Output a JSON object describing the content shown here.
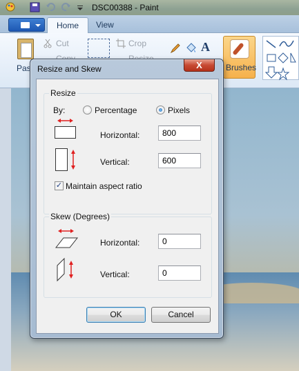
{
  "app": {
    "title": "DSC00388 - Paint",
    "tabs": [
      {
        "label": "Home"
      },
      {
        "label": "View"
      }
    ],
    "clipboard": {
      "paste_label": "Paste",
      "cut_label": "Cut",
      "copy_label": "Copy"
    },
    "image": {
      "crop_label": "Crop",
      "resize_label": "Resize"
    },
    "brushes_label": "Brushes"
  },
  "dialog": {
    "title": "Resize and Skew",
    "close_label": "X",
    "resize": {
      "group_label": "Resize",
      "by_label": "By:",
      "percentage_label": "Percentage",
      "pixels_label": "Pixels",
      "selected_unit": "Pixels",
      "horizontal_label": "Horizontal:",
      "horizontal_value": "800",
      "vertical_label": "Vertical:",
      "vertical_value": "600",
      "maintain_aspect_label": "Maintain aspect ratio",
      "maintain_aspect_checked": true
    },
    "skew": {
      "group_label": "Skew (Degrees)",
      "horizontal_label": "Horizontal:",
      "horizontal_value": "0",
      "vertical_label": "Vertical:",
      "vertical_value": "0"
    },
    "ok_label": "OK",
    "cancel_label": "Cancel"
  },
  "colors": {
    "accent_red_arrow": "#e02020",
    "close_button": "#c74a33",
    "ribbon_blue": "#bcd0e5"
  }
}
